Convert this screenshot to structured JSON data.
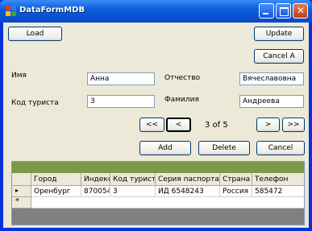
{
  "window": {
    "title": "DataFormMDB"
  },
  "toolbar": {
    "load_label": "Load",
    "update_label": "Update",
    "cancel_all_label": "Cancel A"
  },
  "form": {
    "name_label": "Имя",
    "name_value": "Анна",
    "patronymic_label": "Отчество",
    "patronymic_value": "Вячеславовна",
    "tourist_code_label": "Код туриста",
    "tourist_code_value": "3",
    "surname_label": "Фамилия",
    "surname_value": "Андреева"
  },
  "nav": {
    "first": "<<",
    "prev": "<",
    "position": "3 of 5",
    "next": ">",
    "last": ">>"
  },
  "actions": {
    "add_label": "Add",
    "delete_label": "Delete",
    "cancel_label": "Cancel"
  },
  "grid": {
    "columns": [
      "Город",
      "Индекс",
      "Код туриста",
      "Серия паспорта",
      "Страна",
      "Телефон"
    ],
    "rows": [
      {
        "marker": "▸",
        "cells": [
          "Оренбург",
          "870054",
          "3",
          "ИД 6548243",
          "Россия",
          "585472"
        ]
      }
    ],
    "new_row_marker": "*"
  }
}
